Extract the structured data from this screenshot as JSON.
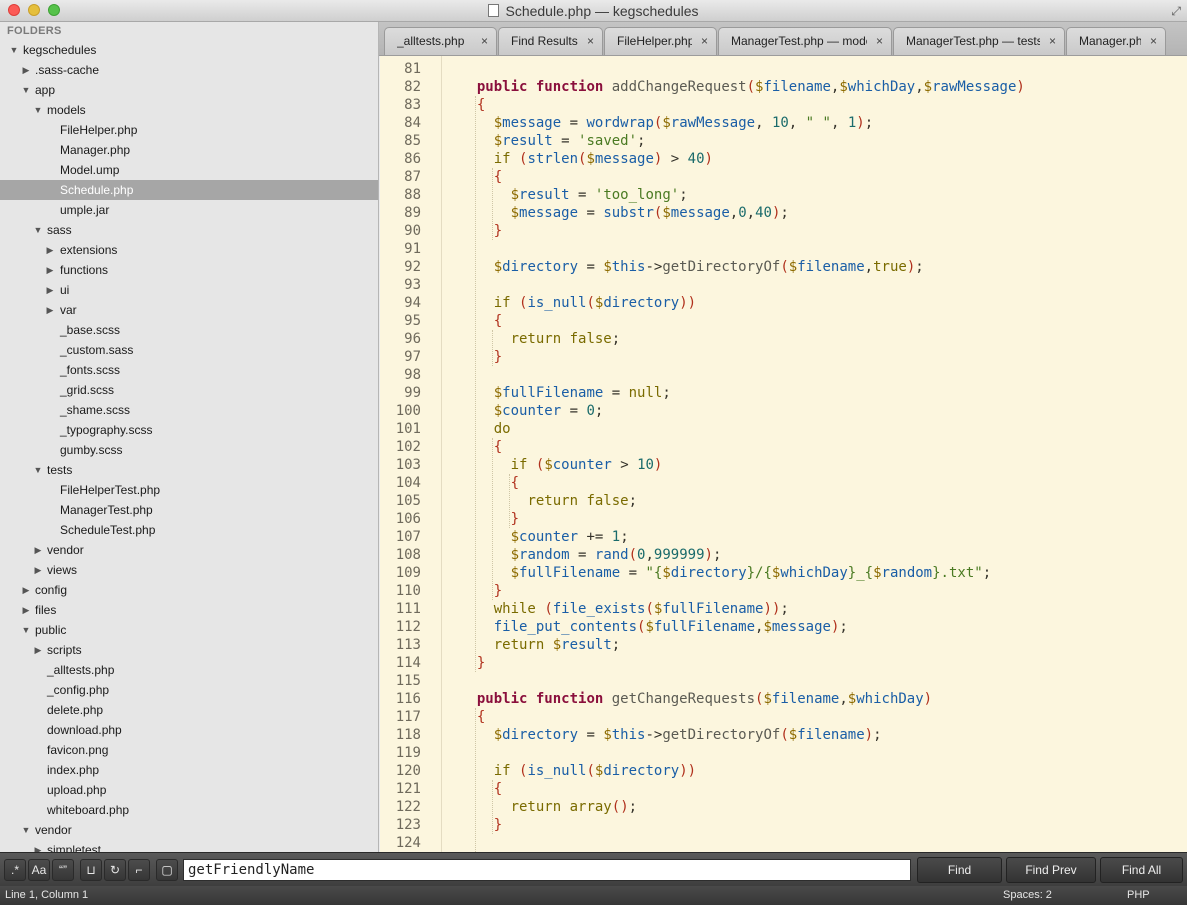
{
  "window": {
    "title": "Schedule.php — kegschedules"
  },
  "sidebar": {
    "header": "FOLDERS",
    "items": [
      {
        "label": "kegschedules",
        "depth": 0,
        "kind": "folder-open"
      },
      {
        "label": ".sass-cache",
        "depth": 1,
        "kind": "folder-closed"
      },
      {
        "label": "app",
        "depth": 1,
        "kind": "folder-open"
      },
      {
        "label": "models",
        "depth": 2,
        "kind": "folder-open"
      },
      {
        "label": "FileHelper.php",
        "depth": 3,
        "kind": "file"
      },
      {
        "label": "Manager.php",
        "depth": 3,
        "kind": "file"
      },
      {
        "label": "Model.ump",
        "depth": 3,
        "kind": "file"
      },
      {
        "label": "Schedule.php",
        "depth": 3,
        "kind": "file",
        "selected": true
      },
      {
        "label": "umple.jar",
        "depth": 3,
        "kind": "file"
      },
      {
        "label": "sass",
        "depth": 2,
        "kind": "folder-open"
      },
      {
        "label": "extensions",
        "depth": 3,
        "kind": "folder-closed"
      },
      {
        "label": "functions",
        "depth": 3,
        "kind": "folder-closed"
      },
      {
        "label": "ui",
        "depth": 3,
        "kind": "folder-closed"
      },
      {
        "label": "var",
        "depth": 3,
        "kind": "folder-closed"
      },
      {
        "label": "_base.scss",
        "depth": 3,
        "kind": "file"
      },
      {
        "label": "_custom.sass",
        "depth": 3,
        "kind": "file"
      },
      {
        "label": "_fonts.scss",
        "depth": 3,
        "kind": "file"
      },
      {
        "label": "_grid.scss",
        "depth": 3,
        "kind": "file"
      },
      {
        "label": "_shame.scss",
        "depth": 3,
        "kind": "file"
      },
      {
        "label": "_typography.scss",
        "depth": 3,
        "kind": "file"
      },
      {
        "label": "gumby.scss",
        "depth": 3,
        "kind": "file"
      },
      {
        "label": "tests",
        "depth": 2,
        "kind": "folder-open"
      },
      {
        "label": "FileHelperTest.php",
        "depth": 3,
        "kind": "file"
      },
      {
        "label": "ManagerTest.php",
        "depth": 3,
        "kind": "file"
      },
      {
        "label": "ScheduleTest.php",
        "depth": 3,
        "kind": "file"
      },
      {
        "label": "vendor",
        "depth": 2,
        "kind": "folder-closed"
      },
      {
        "label": "views",
        "depth": 2,
        "kind": "folder-closed"
      },
      {
        "label": "config",
        "depth": 1,
        "kind": "folder-closed"
      },
      {
        "label": "files",
        "depth": 1,
        "kind": "folder-closed"
      },
      {
        "label": "public",
        "depth": 1,
        "kind": "folder-open"
      },
      {
        "label": "scripts",
        "depth": 2,
        "kind": "folder-closed"
      },
      {
        "label": "_alltests.php",
        "depth": 2,
        "kind": "file"
      },
      {
        "label": "_config.php",
        "depth": 2,
        "kind": "file"
      },
      {
        "label": "delete.php",
        "depth": 2,
        "kind": "file"
      },
      {
        "label": "download.php",
        "depth": 2,
        "kind": "file"
      },
      {
        "label": "favicon.png",
        "depth": 2,
        "kind": "file"
      },
      {
        "label": "index.php",
        "depth": 2,
        "kind": "file"
      },
      {
        "label": "upload.php",
        "depth": 2,
        "kind": "file"
      },
      {
        "label": "whiteboard.php",
        "depth": 2,
        "kind": "file"
      },
      {
        "label": "vendor",
        "depth": 1,
        "kind": "folder-open"
      },
      {
        "label": "simpletest",
        "depth": 2,
        "kind": "folder-closed"
      }
    ]
  },
  "tabs": [
    {
      "label": "_alltests.php"
    },
    {
      "label": "Find Results"
    },
    {
      "label": "FileHelper.php"
    },
    {
      "label": "ManagerTest.php — mode"
    },
    {
      "label": "ManagerTest.php — tests"
    },
    {
      "label": "Manager.php"
    }
  ],
  "tab_close_glyph": "×",
  "editor": {
    "first_line": 81,
    "lines": [
      "",
      "  public function addChangeRequest($filename,$whichDay,$rawMessage)",
      "  {",
      "    $message = wordwrap($rawMessage, 10, \" \", 1);",
      "    $result = 'saved';",
      "    if (strlen($message) > 40)",
      "    {",
      "      $result = 'too_long';",
      "      $message = substr($message,0,40);",
      "    }",
      "",
      "    $directory = $this->getDirectoryOf($filename,true);",
      "",
      "    if (is_null($directory))",
      "    {",
      "      return false;",
      "    }",
      "",
      "    $fullFilename = null;",
      "    $counter = 0;",
      "    do",
      "    {",
      "      if ($counter > 10)",
      "      {",
      "        return false;",
      "      }",
      "      $counter += 1;",
      "      $random = rand(0,999999);",
      "      $fullFilename = \"{$directory}/{$whichDay}_{$random}.txt\";",
      "    }",
      "    while (file_exists($fullFilename));",
      "    file_put_contents($fullFilename,$message);",
      "    return $result;",
      "  }",
      "",
      "  public function getChangeRequests($filename,$whichDay)",
      "  {",
      "    $directory = $this->getDirectoryOf($filename);",
      "",
      "    if (is_null($directory))",
      "    {",
      "      return array();",
      "    }",
      "",
      ""
    ]
  },
  "find": {
    "toggles": [
      {
        "name": "regex-toggle",
        "glyph": ".*"
      },
      {
        "name": "case-sensitive-toggle",
        "glyph": "Aa"
      },
      {
        "name": "whole-word-toggle",
        "glyph": "“”"
      },
      {
        "name": "in-selection-toggle",
        "glyph": "⊔"
      },
      {
        "name": "wrap-toggle",
        "glyph": "↻"
      },
      {
        "name": "highlight-matches-toggle",
        "glyph": "⌐"
      },
      {
        "name": "show-context-toggle",
        "glyph": "▢"
      }
    ],
    "query": "getFriendlyName",
    "find_label": "Find",
    "find_prev_label": "Find Prev",
    "find_all_label": "Find All"
  },
  "status": {
    "position": "Line 1, Column 1",
    "spaces": "Spaces: 2",
    "syntax": "PHP"
  }
}
